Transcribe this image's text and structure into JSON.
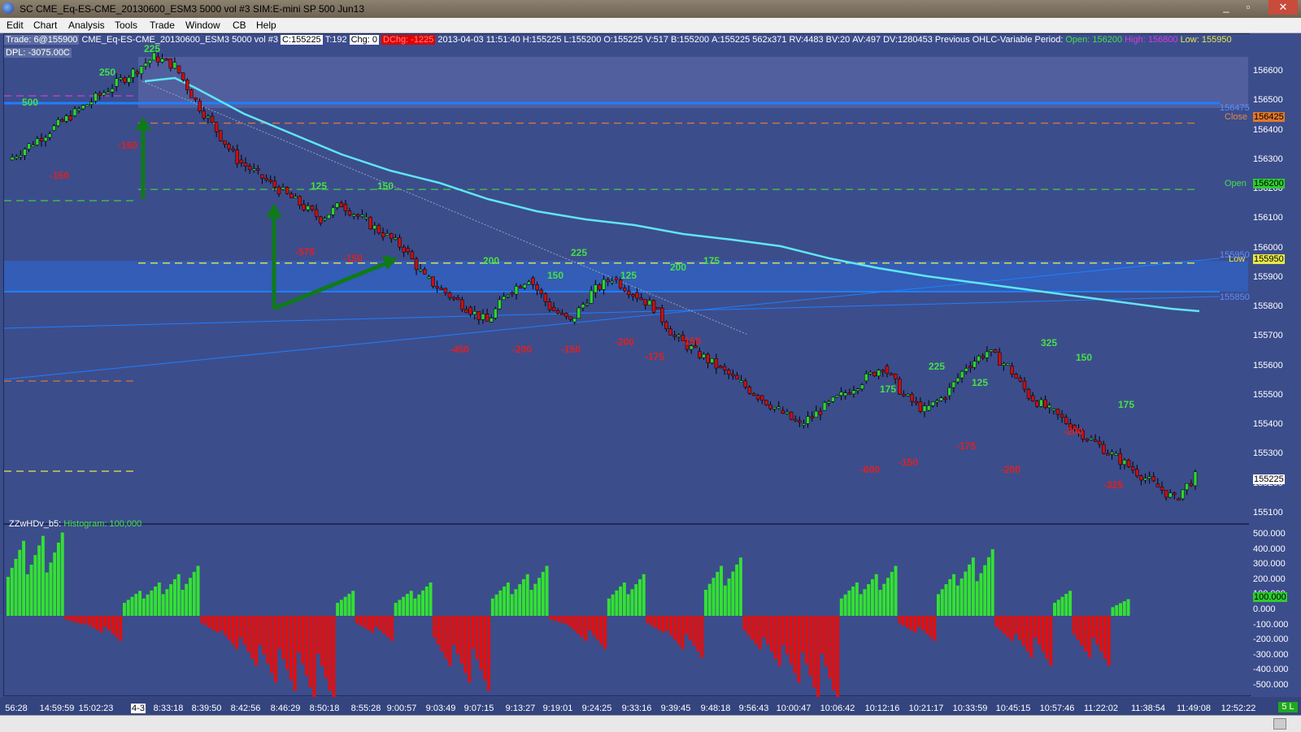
{
  "window": {
    "title": "SC CME_Eq-ES-CME_20130600_ESM3  5000 vol  #3  SIM:E-mini SP 500 Jun13",
    "buttons": [
      "_",
      "▫",
      "✕"
    ]
  },
  "menu": [
    "Edit",
    "Chart",
    "Analysis",
    "Tools",
    "Trade",
    "Window",
    "CB",
    "Help"
  ],
  "info": {
    "trade": "Trade: 6@155900",
    "symbol": "CME_Eq-ES-CME_20130600_ESM3  5000 vol  #3",
    "c": "C:155225",
    "t": "T:192",
    "chg": "Chg: 0",
    "dchg": "DChg: -1225",
    "datetime": "2013-04-03 11:51:40",
    "h": "H:155225",
    "l": "L:155200",
    "o": "O:155225",
    "v": "V:517",
    "b": "B:155200",
    "a": "A:155225",
    "size": "562x371",
    "rv": "RV:4483",
    "bv": "BV:20",
    "av": "AV:497",
    "dv": "DV:1280453",
    "prev": "Previous OHLC-Variable Period:",
    "open": "Open: 156200",
    "high": "High: 156800",
    "low": "Low: 155950"
  },
  "dpl": "DPL: -3075.00C",
  "indicator": {
    "name": "ZZwHDv_b5:",
    "histogram": "Histogram: 100,000"
  },
  "price_axis": [
    "156600",
    "156500",
    "156400",
    "156300",
    "156200",
    "156100",
    "156000",
    "155900",
    "155800",
    "155700",
    "155600",
    "155500",
    "155400",
    "155300",
    "155200",
    "155100"
  ],
  "hist_axis": [
    "500.000",
    "400.000",
    "300.000",
    "200.000",
    "100.000",
    "0.000",
    "-100.000",
    "-200.000",
    "-300.000",
    "-400.000",
    "-500.000"
  ],
  "level_labels": {
    "close": "Close",
    "close_val": "156425",
    "open": "Open",
    "open_val": "156200",
    "low": "Low",
    "low_val": "155950",
    "blue_top": "156475",
    "blue_low": "155850",
    "blue_mid": "155950",
    "last": "155225",
    "hist_last": "100.000"
  },
  "time_axis": [
    "56:28",
    "14:59:59",
    "15:02:23",
    "4-3",
    "8:33:18",
    "8:39:50",
    "8:42:56",
    "8:46:29",
    "8:50:18",
    "8:55:28",
    "9:00:57",
    "9:03:49",
    "9:07:15",
    "9:13:27",
    "9:19:01",
    "9:24:25",
    "9:33:16",
    "9:39:45",
    "9:48:18",
    "9:56:43",
    "10:00:47",
    "10:06:42",
    "10:12:16",
    "10:21:17",
    "10:33:59",
    "10:45:15",
    "10:57:46",
    "11:22:02",
    "11:38:54",
    "11:49:08",
    "12:52:22"
  ],
  "status": "5 L",
  "chart_data": {
    "type": "candlestick",
    "swing_labels": [
      {
        "text": "250",
        "color": "green"
      },
      {
        "text": "225",
        "color": "green"
      },
      {
        "text": "500",
        "color": "green"
      },
      {
        "text": "-150",
        "color": "red"
      },
      {
        "text": "-150",
        "color": "red"
      },
      {
        "text": "125",
        "color": "green"
      },
      {
        "text": "150",
        "color": "green"
      },
      {
        "text": "-575",
        "color": "red"
      },
      {
        "text": "-150",
        "color": "red"
      },
      {
        "text": "200",
        "color": "green"
      },
      {
        "text": "225",
        "color": "green"
      },
      {
        "text": "150",
        "color": "green"
      },
      {
        "text": "125",
        "color": "green"
      },
      {
        "text": "200",
        "color": "green"
      },
      {
        "text": "175",
        "color": "green"
      },
      {
        "text": "-450",
        "color": "red"
      },
      {
        "text": "-200",
        "color": "red"
      },
      {
        "text": "-150",
        "color": "red"
      },
      {
        "text": "-200",
        "color": "red"
      },
      {
        "text": "-175",
        "color": "red"
      },
      {
        "text": "-150",
        "color": "red"
      },
      {
        "text": "175",
        "color": "green"
      },
      {
        "text": "225",
        "color": "green"
      },
      {
        "text": "125",
        "color": "green"
      },
      {
        "text": "325",
        "color": "green"
      },
      {
        "text": "150",
        "color": "green"
      },
      {
        "text": "175",
        "color": "green"
      },
      {
        "text": "-600",
        "color": "red"
      },
      {
        "text": "-150",
        "color": "red"
      },
      {
        "text": "-175",
        "color": "red"
      },
      {
        "text": "-200",
        "color": "red"
      },
      {
        "text": "-200",
        "color": "red"
      },
      {
        "text": "-325",
        "color": "red"
      }
    ],
    "close_path": [
      156300,
      156350,
      156400,
      156450,
      156500,
      156550,
      156600,
      156650,
      156620,
      156500,
      156400,
      156300,
      156250,
      156200,
      156150,
      156100,
      156150,
      156100,
      156050,
      156000,
      155900,
      155850,
      155800,
      155750,
      155850,
      155900,
      155800,
      155750,
      155850,
      155900,
      155850,
      155800,
      155700,
      155650,
      155600,
      155550,
      155500,
      155450,
      155400,
      155450,
      155500,
      155550,
      155600,
      155500,
      155450,
      155500,
      155600,
      155650,
      155600,
      155500,
      155450,
      155400,
      155350,
      155300,
      155250,
      155200,
      155150,
      155225
    ],
    "histogram": [
      450,
      480,
      500,
      -50,
      -100,
      -150,
      150,
      200,
      250,
      300,
      -100,
      -200,
      -300,
      -400,
      -450,
      -500,
      -520,
      150,
      -100,
      -150,
      150,
      200,
      -300,
      -400,
      -450,
      200,
      250,
      300,
      -50,
      -150,
      -200,
      200,
      250,
      -100,
      -200,
      -250,
      300,
      350,
      -200,
      -300,
      -400,
      -500,
      -520,
      200,
      250,
      300,
      -100,
      -150,
      250,
      350,
      400,
      -150,
      -250,
      -300,
      150,
      -250,
      -300,
      100
    ],
    "levels": [
      {
        "name": "Close",
        "value": 156425
      },
      {
        "name": "Open",
        "value": 156200
      },
      {
        "name": "Low",
        "value": 155950
      }
    ],
    "ylim": [
      155100,
      156650
    ],
    "hist_ylim": [
      -500,
      500
    ]
  }
}
